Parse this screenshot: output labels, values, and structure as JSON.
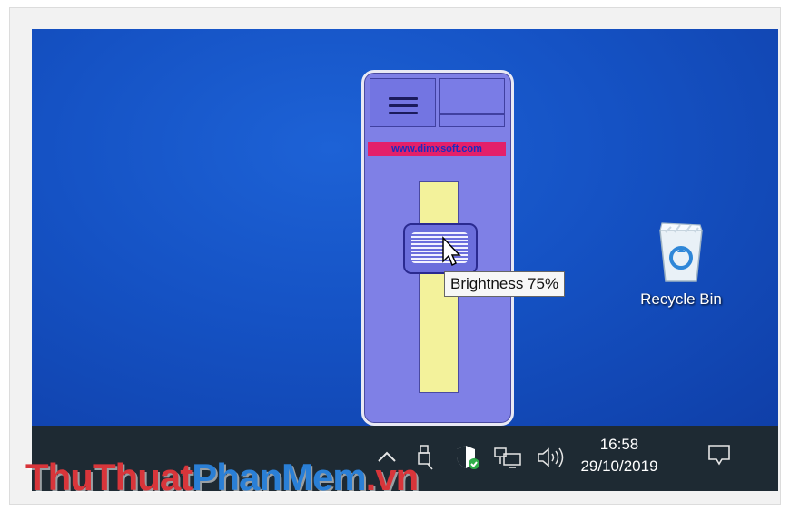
{
  "gadget": {
    "website": "www.dimxsoft.com",
    "brightness_value": 0.75
  },
  "tooltip": {
    "text": "Brightness 75%"
  },
  "desktop_icon": {
    "label": "Recycle Bin"
  },
  "tray": {
    "time": "16:58",
    "date": "29/10/2019"
  },
  "watermark": {
    "part1": "ThuThuat",
    "part2": "PhanMem",
    "part3": ".vn"
  },
  "icons": {
    "menu": "hamburger-icon",
    "overflow": "chevron-up-icon",
    "usb": "usb-icon",
    "security": "shield-icon",
    "network": "network-icon",
    "volume": "volume-icon",
    "notifications": "notification-icon",
    "recycle": "recycle-bin-icon",
    "cursor": "mouse-cursor-icon"
  },
  "colors": {
    "desktop": "#1552c4",
    "gadget": "#7f80e6",
    "banner": "#e3206a",
    "track": "#f3f29b",
    "taskbar": "#1e2a33"
  }
}
